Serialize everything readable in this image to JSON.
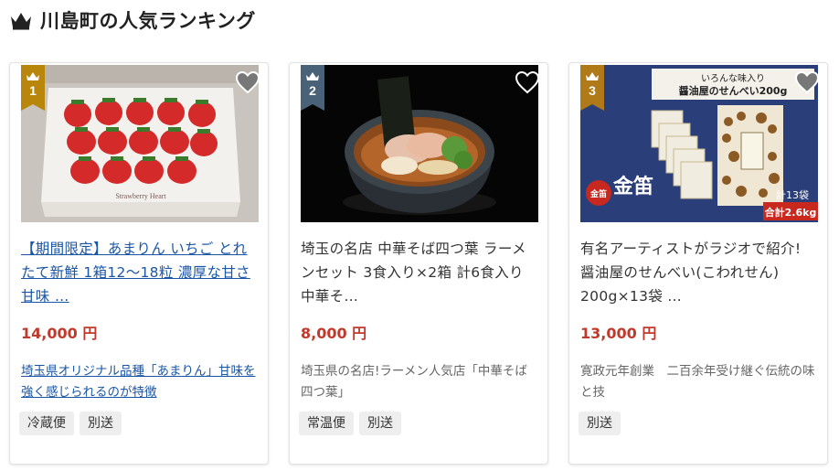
{
  "section": {
    "title": "川島町の人気ランキング",
    "icon": "crown-icon"
  },
  "colors": {
    "rank_1": "#b8860b",
    "rank_2": "#4a6278",
    "rank_3": "#b07a18",
    "price": "#c0392b",
    "link": "#1a56a6"
  },
  "cards": [
    {
      "rank": "1",
      "title": "【期間限定】あまりん いちご とれたて新鮮 1箱12〜18粒 濃厚な甘さ 甘味 …",
      "price": "14,000 円",
      "description": "埼玉県オリジナル品種「あまりん」甘味を強く感じられるのが特徴",
      "tags": [
        "冷蔵便",
        "別送"
      ],
      "image_text": "Strawberry Heart",
      "image": "strawberry-box-image"
    },
    {
      "rank": "2",
      "title": "埼玉の名店 中華そば四つ葉 ラーメンセット 3食入り×2箱 計6食入り 中華そ…",
      "price": "8,000 円",
      "description": "埼玉県の名店!ラーメン人気店「中華そば　四つ葉」",
      "tags": [
        "常温便",
        "別送"
      ],
      "image": "ramen-bowl-image"
    },
    {
      "rank": "3",
      "title": "有名アーティストがラジオで紹介! 醤油屋のせんべい(こわれせん) 200g×13袋 …",
      "price": "13,000 円",
      "description": "寛政元年創業　二百余年受け継ぐ伝統の味と技",
      "tags": [
        "別送"
      ],
      "image": "senbei-bags-image",
      "image_text": {
        "top_line1": "いろんな味入り",
        "top_line2": "醤油屋のせんべい200g",
        "brand": "金笛",
        "count": "計13袋",
        "total": "合計2.6kg"
      }
    }
  ]
}
